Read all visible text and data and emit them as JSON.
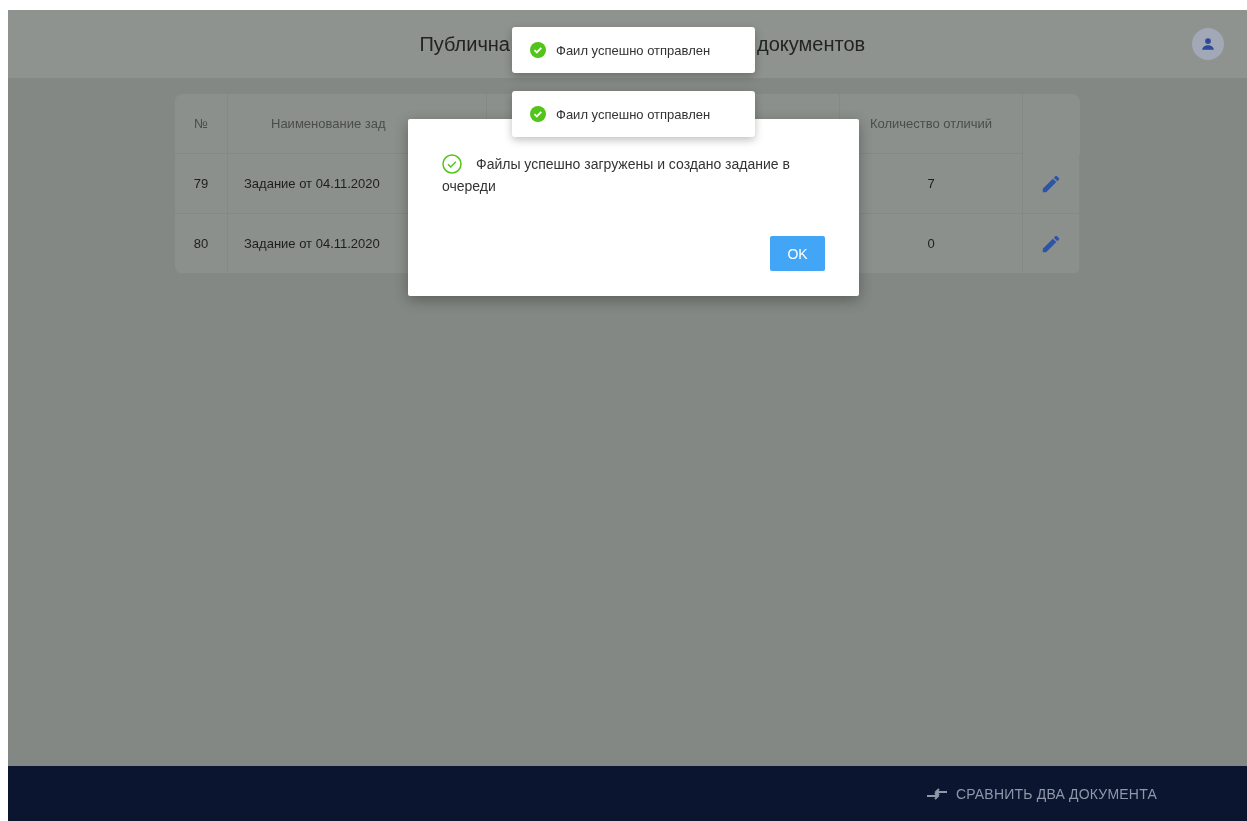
{
  "header": {
    "title_parts": [
      "Публична",
      "документов"
    ]
  },
  "table": {
    "columns": [
      "№",
      "Наименование зад",
      "Количество отличий"
    ],
    "rows": [
      {
        "number": "79",
        "name": "Задание от 04.11.2020",
        "differences": "7"
      },
      {
        "number": "80",
        "name": "Задание от 04.11.2020",
        "differences": "0"
      }
    ]
  },
  "toasts": [
    {
      "text": "Фаил успешно отправлен"
    },
    {
      "text": "Фаил успешно отправлен"
    }
  ],
  "dialog": {
    "message": "Файлы успешно загружены и создано задание в очереди",
    "button": "OK"
  },
  "footer": {
    "compare_button": "СРАВНИТЬ ДВА ДОКУМЕНТА"
  }
}
